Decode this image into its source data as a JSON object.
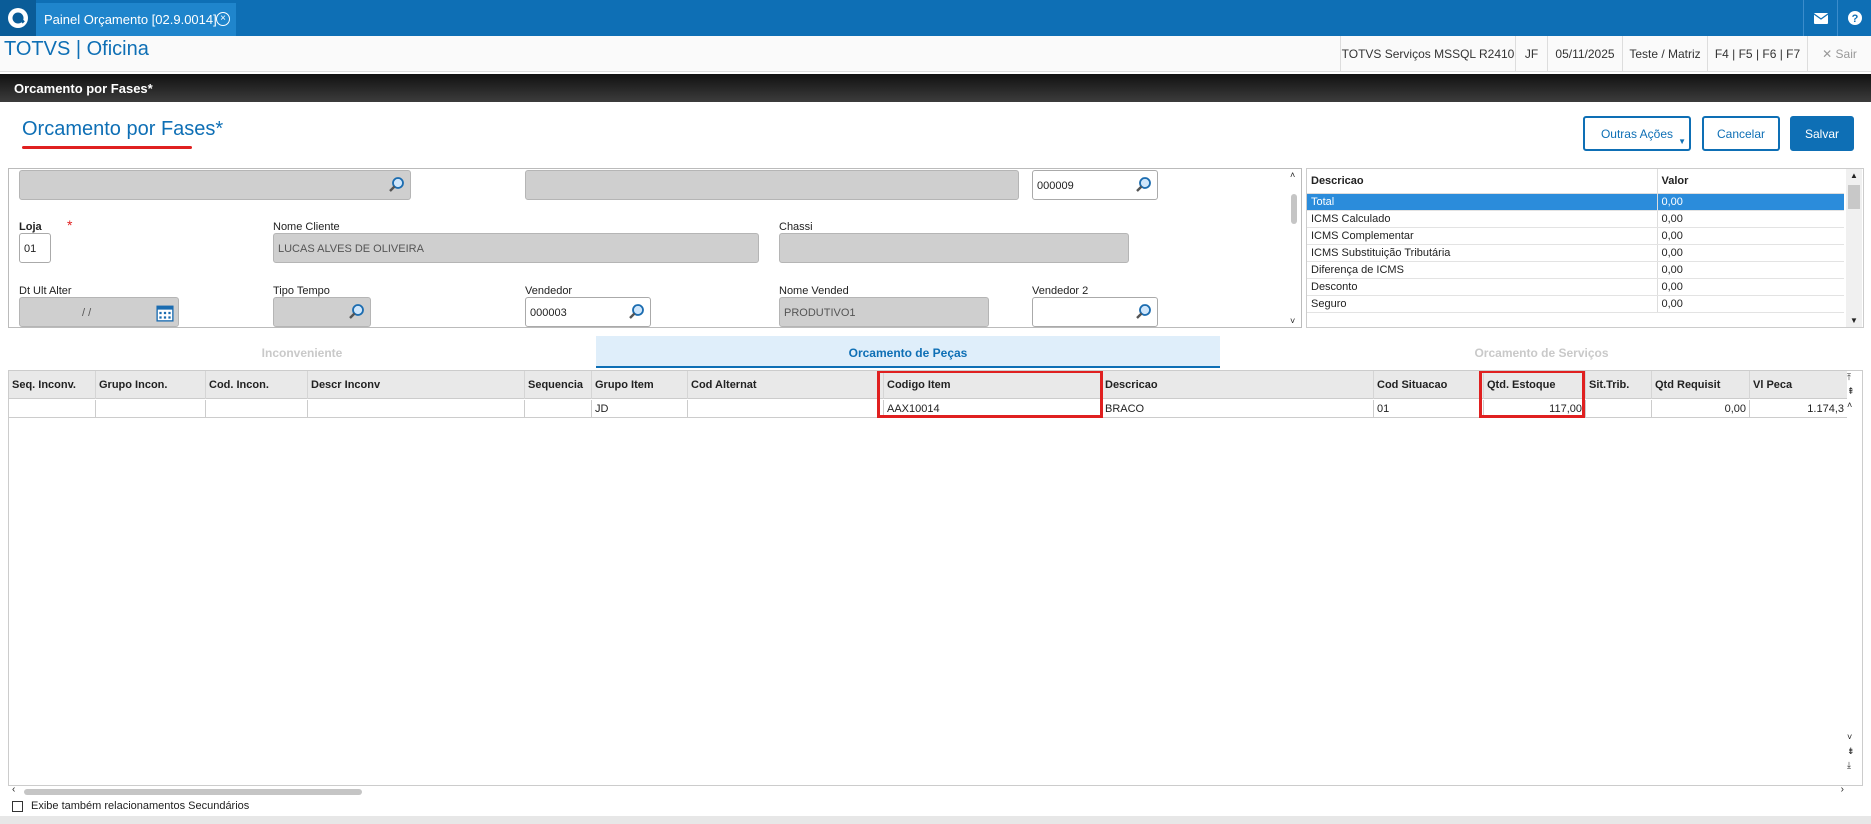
{
  "topbar": {
    "tab_title": "Painel Orçamento [02.9.0014]",
    "close_glyph": "×",
    "mail_icon": "mail-icon",
    "help_icon": "help-icon"
  },
  "header": {
    "app_title": "TOTVS | Oficina",
    "environment": "TOTVS Serviços MSSQL R2410",
    "user": "JF",
    "date": "05/11/2025",
    "branch": "Teste / Matriz",
    "shortcuts": "F4 | F5 | F6 | F7",
    "exit_label": "Sair",
    "exit_glyph": "✕"
  },
  "band": {
    "title": "Orcamento por Fases*"
  },
  "page": {
    "title": "Orcamento por Fases*",
    "required_mark": "*"
  },
  "actions": {
    "more_label": "Outras Ações",
    "cancel_label": "Cancelar",
    "save_label": "Salvar"
  },
  "form": {
    "field_top3": "000009",
    "loja_label": "Loja",
    "loja_value": "01",
    "nome_cliente_label": "Nome Cliente",
    "nome_cliente_value": "LUCAS ALVES DE OLIVEIRA",
    "chassi_label": "Chassi",
    "chassi_value": "",
    "dt_label": "Dt Ult Alter",
    "dt_value": "/ /",
    "tipo_tempo_label": "Tipo Tempo",
    "tipo_tempo_value": "",
    "vendedor_label": "Vendedor",
    "vendedor_value": "000003",
    "nome_vended_label": "Nome Vended",
    "nome_vended_value": "PRODUTIVO1",
    "vendedor2_label": "Vendedor 2",
    "vendedor2_value": ""
  },
  "totals": {
    "col_desc": "Descricao",
    "col_val": "Valor",
    "rows": [
      {
        "d": "Total",
        "v": "0,00"
      },
      {
        "d": "ICMS Calculado",
        "v": "0,00"
      },
      {
        "d": "ICMS Complementar",
        "v": "0,00"
      },
      {
        "d": "ICMS Substituição Tributária",
        "v": "0,00"
      },
      {
        "d": "Diferença de ICMS",
        "v": "0,00"
      },
      {
        "d": "Desconto",
        "v": "0,00"
      },
      {
        "d": "Seguro",
        "v": "0,00"
      }
    ]
  },
  "tabs": [
    "Inconveniente",
    "Orcamento de Peças",
    "Orcamento de Serviços"
  ],
  "grid": {
    "headers": [
      "Seq. Inconv.",
      "Grupo Incon.",
      "Cod. Incon.",
      "Descr Inconv",
      "Sequencia",
      "Grupo Item",
      "Cod Alternat",
      "Codigo Item",
      "Descricao",
      "Cod Situacao",
      "Qtd. Estoque",
      "Sit.Trib.",
      "Qtd Requisit",
      "Vl Peca"
    ],
    "row": [
      "",
      "",
      "",
      "",
      "",
      "JD",
      "",
      "AAX10014",
      "BRACO",
      "01",
      "117,00",
      "",
      "0,00",
      "1.174,3"
    ]
  },
  "footer": {
    "checkbox_label": "Exibe também relacionamentos Secundários"
  },
  "colors": {
    "brand": "#0e6fb5",
    "highlight": "#e02020",
    "selected_row": "#2b8cdb"
  }
}
